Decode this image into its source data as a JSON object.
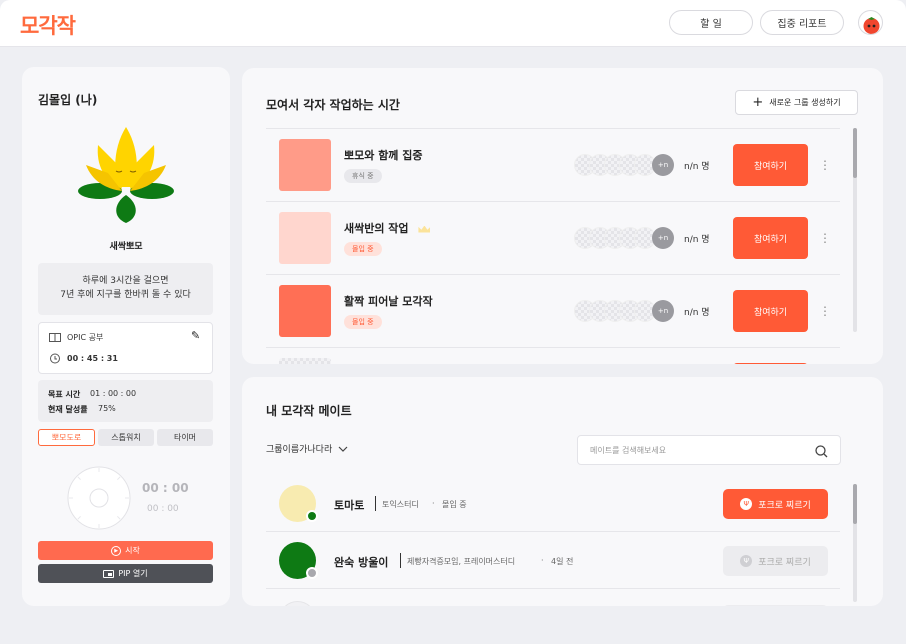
{
  "header": {
    "logo": "모각작",
    "nav": [
      {
        "label": "할 일"
      },
      {
        "label": "집중 리포트"
      }
    ]
  },
  "profile": {
    "name": "김몰입 (나)",
    "plant_name": "새싹뽀모",
    "quote_line1": "하루에 3시간을 걸으면",
    "quote_line2": "7년 후에 지구를 한바퀴 돌 수 있다",
    "task": {
      "label": "OPIC 공부",
      "time": "00 : 45 : 31"
    },
    "goal": {
      "target_label": "목표 시간",
      "target_value": "01 : 00 : 00",
      "rate_label": "현재 달성률",
      "rate_value": "75%"
    },
    "modes": [
      {
        "label": "뽀모도로",
        "active": true
      },
      {
        "label": "스톱워치",
        "active": false
      },
      {
        "label": "타이머",
        "active": false
      }
    ],
    "timer": {
      "main": "00 : 00",
      "sub": "00 : 00"
    },
    "start_label": "시작",
    "pip_label": "PIP 열기"
  },
  "groups": {
    "title": "모여서 각자 작업하는 시간",
    "new_group_label": "새로운 그룹 생성하기",
    "rows": [
      {
        "title": "뽀모와 함께 집중",
        "status": "휴식 중",
        "count": "n/n 명",
        "more": "+n",
        "join": "참여하기",
        "thumb_color": "#FF9B88",
        "status_type": "rest"
      },
      {
        "title": "새싹반의 작업",
        "status": "몰입 중",
        "count": "n/n 명",
        "more": "+n",
        "join": "참여하기",
        "thumb_color": "#FFD6CE",
        "status_type": "focus",
        "crown": true
      },
      {
        "title": "활짝 피어날 모각작",
        "status": "몰입 중",
        "count": "n/n 명",
        "more": "+n",
        "join": "참여하기",
        "thumb_color": "#FF6F55",
        "status_type": "focus"
      }
    ]
  },
  "mates": {
    "title": "내 모각작 메이트",
    "sort_label": "그룹이름가나다라",
    "search_placeholder": "메이트를 검색해보세요",
    "rows": [
      {
        "name": "토마토",
        "group": "토익스터디",
        "status": "몰입 중",
        "poke": "포크로 찌르기",
        "avatar_color": "#F8EBB0",
        "dot_color": "#0E7A14",
        "active": true
      },
      {
        "name": "완숙 방울이",
        "group": "제빵자격증모임, 프레이머스터디",
        "status": "4일 전",
        "poke": "포크로 찌르기",
        "avatar_color": "#0E7A14",
        "dot_color": "#A9A9AE",
        "active": false
      }
    ]
  },
  "colors": {
    "accent": "#FF5A36",
    "dark_button": "#4F5157"
  }
}
